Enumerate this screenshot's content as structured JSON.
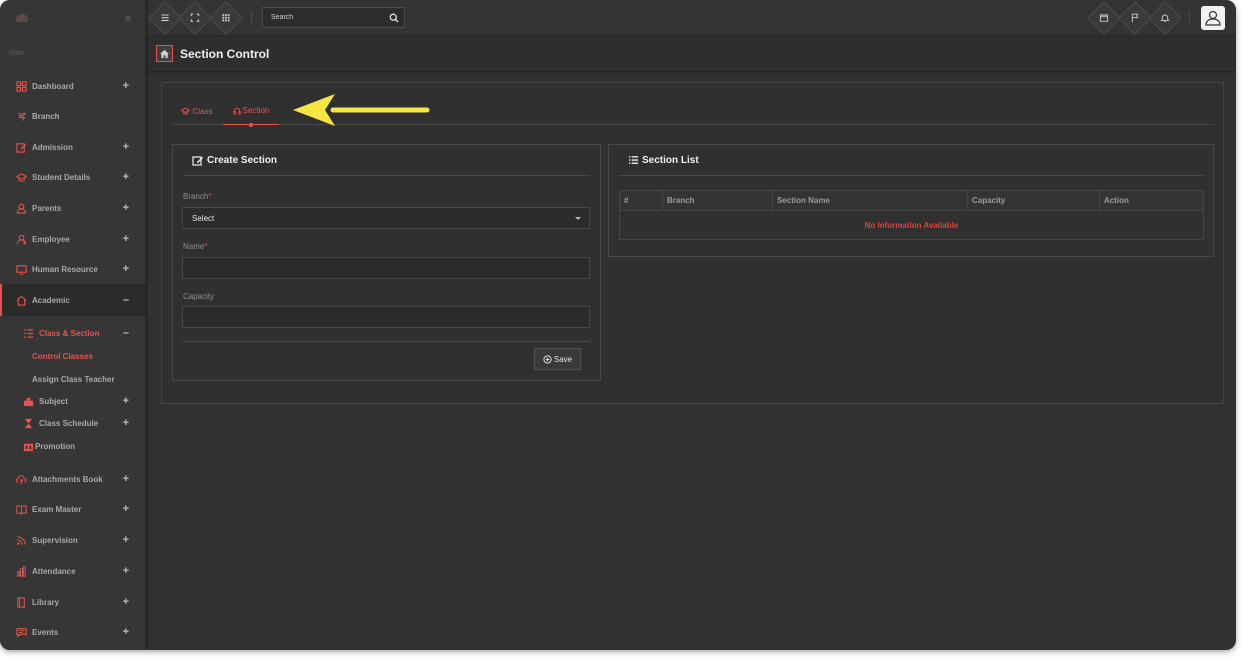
{
  "sidebar": {
    "section_label": "Main",
    "items": [
      {
        "label": "Dashboard",
        "icon": "dashboard-icon",
        "expandable": true
      },
      {
        "label": "Branch",
        "icon": "branch-icon",
        "expandable": false
      },
      {
        "label": "Admission",
        "icon": "edit-icon",
        "expandable": true
      },
      {
        "label": "Student Details",
        "icon": "graduation-cap-icon",
        "expandable": true
      },
      {
        "label": "Parents",
        "icon": "user-icon",
        "expandable": true
      },
      {
        "label": "Employee",
        "icon": "employee-icon",
        "expandable": true
      },
      {
        "label": "Human Resource",
        "icon": "monitor-icon",
        "expandable": true
      },
      {
        "label": "Academic",
        "icon": "home-icon",
        "expandable": true,
        "expanded": true
      },
      {
        "label": "Attachments Book",
        "icon": "cloud-upload-icon",
        "expandable": true
      },
      {
        "label": "Exam Master",
        "icon": "book-icon",
        "expandable": true
      },
      {
        "label": "Supervision",
        "icon": "rss-icon",
        "expandable": true
      },
      {
        "label": "Attendance",
        "icon": "chart-icon",
        "expandable": true
      },
      {
        "label": "Library",
        "icon": "library-icon",
        "expandable": true
      },
      {
        "label": "Events",
        "icon": "chat-icon",
        "expandable": true
      }
    ],
    "academic_sub": {
      "class_section": "Class & Section",
      "control_classes": "Control Classes",
      "assign_class_teacher": "Assign Class Teacher",
      "subject": "Subject",
      "class_schedule": "Class Schedule",
      "promotion": "Promotion"
    },
    "expand_symbol": "+",
    "collapse_symbol": "–"
  },
  "topbar": {
    "search_placeholder": "Search"
  },
  "page": {
    "title": "Section Control"
  },
  "tabs": [
    {
      "label": "Class",
      "active": false
    },
    {
      "label": "Section",
      "active": true
    }
  ],
  "create_section": {
    "title": "Create Section",
    "branch_label": "Branch",
    "branch_value": "Select",
    "name_label": "Name",
    "capacity_label": "Capacity",
    "required_mark": "*",
    "save_label": "Save"
  },
  "section_list": {
    "title": "Section List",
    "columns": [
      "#",
      "Branch",
      "Section Name",
      "Capacity",
      "Action"
    ],
    "empty_message": "No Information Available"
  },
  "colors": {
    "accent": "#e8534f",
    "annotation_arrow": "#f5e642",
    "background": "#313131"
  }
}
